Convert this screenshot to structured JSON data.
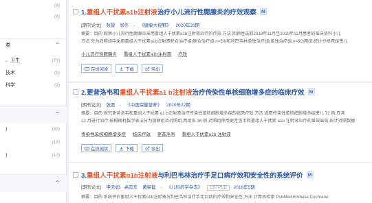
{
  "sidebar": {
    "top_counts": [
      "(8)",
      "(8)"
    ],
    "section1": {
      "label": "类",
      "items": [
        {
          "label": "、卫生",
          "count": "(73)"
        },
        {
          "label": "技术",
          "count": "(8)"
        },
        {
          "label": "科学",
          "count": "(2)"
        }
      ]
    },
    "section2": {
      "items": [
        {
          "label": ")",
          "count": "(40)"
        },
        {
          "label": "",
          "count": "(12)"
        },
        {
          "label": ")",
          "count": "(10)"
        }
      ]
    }
  },
  "results": [
    {
      "index": "1.",
      "title_hl": "重组人干扰素a1b注射液",
      "title_rest": "治疗小儿流行性腮腺炎的疗效观察",
      "badge": "M",
      "meta": {
        "type": "[期刊论文]",
        "authors": [
          "张景",
          "张冬"
        ],
        "journal": "《健康大视野》",
        "date": "2020年20期"
      },
      "abstract_line1": "摘要：目的 观察小儿流行性腮腺炎采用重组人干扰素a1b注射液治疗的疗效.方法 回顾性选取2018年11月至2019年11月患者的临床资料小儿",
      "abstract_line2": "方法 分为对照组中采用重组人干扰素a1b注射液联合治疗组(联合治疗组,n=50)和利巴韦林单独治疗组(单独治疗组,n=50)两组,统计分析两组患儿",
      "keywords": [
        "小儿流行性腮腺炎",
        "重组人干扰素a1b注射液",
        "疗效"
      ],
      "actions": {
        "read": "在线阅读",
        "download": "下载",
        "export": "导出"
      }
    },
    {
      "index": "2.",
      "title_part1": "更昔洛韦和",
      "title_hl": "重组人干扰素a1 b注射液",
      "title_rest": "治疗传染性单核细胞增多症的临床疗效",
      "badge": "M",
      "meta": {
        "type": "[期刊论文]",
        "authors": [
          "张愿"
        ],
        "journal": "《中国保健营养》",
        "date": "2020年22期"
      },
      "abstract_line1": "摘要：目的 探究更昔洛韦和重组人干扰素 a1 b注射液治疗传染性单核细胞增多症的临床疗效.方法 选取传染性单核细胞增多症患儿 72 例,在其",
      "abstract_line2": "12 月进行治疗,按照随机数字表法分为观察组及对照组,两组各 36 例,对照组使用更昔洛韦和重组人干扰素 a1b 注射液治疗的显效显效,统计对照数据",
      "keywords": [
        "传染性单核细胞增多症",
        "临床疗效",
        "更昔洛韦",
        "重组人干扰素a1b 注射液"
      ],
      "actions": {
        "read": "在线阅读",
        "download": "下载",
        "export": "导出"
      }
    },
    {
      "index": "3.",
      "title_hl": "重组人干扰素α1b注射液",
      "title_rest": "与利巴韦林治疗手足口病疗效和安全性的系统评价",
      "badge": "M",
      "meta": {
        "type": "[期刊论文]",
        "authors": [
          "申天如",
          "高向东",
          "黄荣猛"
        ],
        "journal": "《儿科药学杂志》",
        "tag": "CSTPCD",
        "date": "2018年5期"
      },
      "abstract_line1": "摘要：目的 系统评价重组人干扰素α1b注射液与利巴韦林治疗手足口病的疗效和安全性,方法 计算机检索 PubMed,Embase,Cochrane",
      "abstract_line2": "",
      "keywords": [],
      "actions": {
        "read": "在线阅读",
        "download": "下载",
        "export": "导出"
      }
    }
  ],
  "colors": {
    "link": "#2c58a4",
    "highlight": "#e4572e",
    "page_bg": "#eef1f6"
  },
  "icons": {
    "read": "book-icon",
    "download": "download-icon",
    "export": "export-icon",
    "collapse": "chevron-up-icon",
    "expand": "chevron-down-icon"
  }
}
